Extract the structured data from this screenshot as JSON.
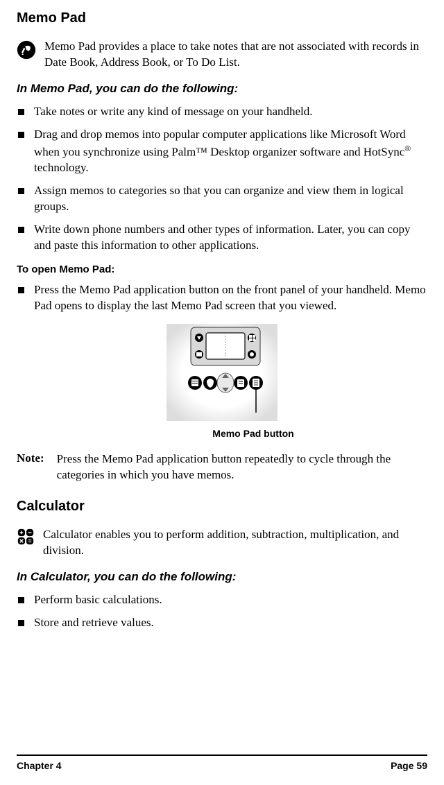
{
  "heading_memopad": "Memo Pad",
  "intro_memopad": "Memo Pad provides a place to take notes that are not associated with records in Date Book, Address Book, or To Do List.",
  "subheading_memopad_capabilities": "In Memo Pad, you can do the following:",
  "memopad_bullets": {
    "b1": "Take notes or write any kind of message on your handheld.",
    "b2_pre": "Drag and drop memos into popular computer applications like Microsoft Word when you synchronize using Palm",
    "b2_tm": "™",
    "b2_mid": " Desktop organizer software and HotSync",
    "b2_reg": "®",
    "b2_post": " technology.",
    "b3": "Assign memos to categories so that you can organize and view them in logical groups.",
    "b4": "Write down phone numbers and other types of information. Later, you can copy and paste this information to other applications."
  },
  "subheading_open_memopad": "To open Memo Pad:",
  "open_memopad_bullet": "Press the Memo Pad application button on the front panel of your handheld. Memo Pad opens to display the last Memo Pad screen that you viewed.",
  "caption_memopad_button": "Memo Pad button",
  "note_label": "Note:",
  "note_body": "Press the Memo Pad application button repeatedly to cycle through the categories in which you have memos.",
  "heading_calculator": "Calculator",
  "intro_calculator": "Calculator enables you to perform addition, subtraction, multiplication, and division.",
  "subheading_calculator_capabilities": "In Calculator, you can do the following:",
  "calculator_bullets": {
    "b1": "Perform basic calculations.",
    "b2": "Store and retrieve values."
  },
  "footer_left": "Chapter 4",
  "footer_right": "Page 59"
}
